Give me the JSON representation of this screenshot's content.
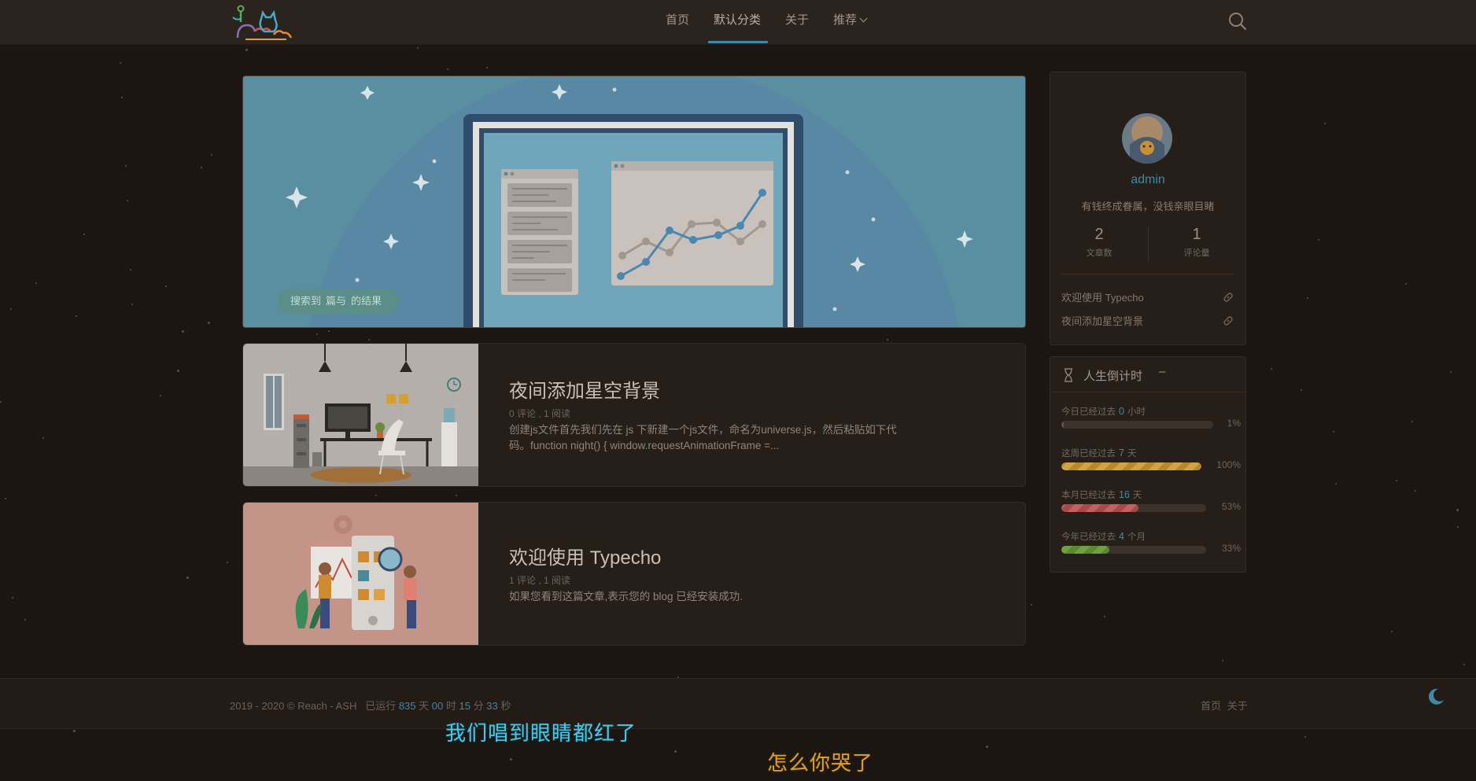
{
  "nav": {
    "items": [
      {
        "label": "首页"
      },
      {
        "label": "默认分类",
        "active": true
      },
      {
        "label": "关于"
      },
      {
        "label": "推荐",
        "has_dropdown": true
      }
    ],
    "icons": {
      "search": "search-icon",
      "logo": "cat-logo"
    }
  },
  "hero": {
    "pill": {
      "part1": "搜索到",
      "part2": "篇与",
      "part3": "的结果"
    }
  },
  "posts": [
    {
      "title": "夜间添加星空背景",
      "meta": "0 评论 , 1 阅读",
      "excerpt": "创建js文件首先我们先在 js 下新建一个js文件，命名为universe.js，然后粘贴如下代码。function night() { window.requestAnimationFrame =..."
    },
    {
      "title": "欢迎使用 Typecho",
      "meta": "1 评论 , 1 阅读",
      "excerpt": "如果您看到这篇文章,表示您的 blog 已经安装成功."
    }
  ],
  "profile": {
    "username": "admin",
    "motto": "有钱终成眷属，没钱亲眼目睹",
    "stats": [
      {
        "value": "2",
        "label": "文章数"
      },
      {
        "value": "1",
        "label": "评论量"
      }
    ],
    "links": [
      {
        "label": "欢迎使用 Typecho"
      },
      {
        "label": "夜间添加星空背景"
      }
    ]
  },
  "countdown": {
    "title": "人生倒计时",
    "toggle": "–",
    "items": [
      {
        "prefix": "今日已经过去",
        "value": "0",
        "unit": "小时",
        "percent_label": "1%",
        "fill": 0.01,
        "style": "plain-dark"
      },
      {
        "prefix": "这周已经过去",
        "value": "7",
        "unit": "天",
        "percent_label": "100%",
        "fill": 1.0,
        "style": "stripe-yellow"
      },
      {
        "prefix": "本月已经过去",
        "value": "16",
        "unit": "天",
        "percent_label": "53%",
        "fill": 0.53,
        "style": "stripe-red"
      },
      {
        "prefix": "今年已经过去",
        "value": "4",
        "unit": "个月",
        "percent_label": "33%",
        "fill": 0.33,
        "style": "stripe-green"
      }
    ]
  },
  "footer": {
    "copyright": "2019 - 2020 © Reach - ASH",
    "runtime_label": "已运行",
    "days": "835",
    "days_unit": "天",
    "hours": "00",
    "hours_unit": "时",
    "minutes": "15",
    "minutes_unit": "分",
    "seconds": "33",
    "seconds_unit": "秒",
    "links": [
      "首页",
      "关于"
    ]
  },
  "lyrics": {
    "line1": "我们唱到眼睛都红了",
    "line2": "怎么你哭了"
  },
  "colors": {
    "accent": "#3e8aa8",
    "background": "#1c1612",
    "header": "#2a231e"
  }
}
